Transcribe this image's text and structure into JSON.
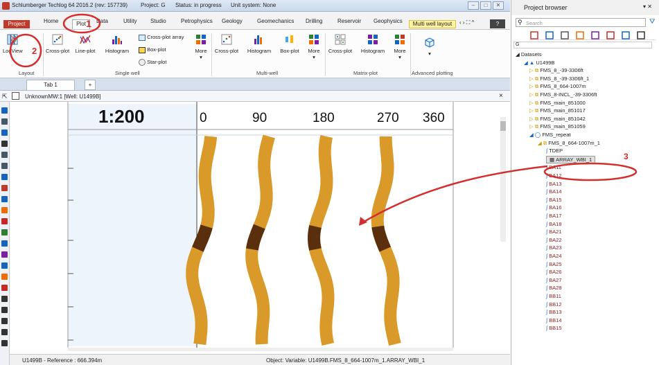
{
  "window": {
    "title": "Schlumberger Techlog 64 2016.2 (rev: 157739)",
    "project": "Project: G",
    "status": "Status: in progress",
    "unit_system": "Unit system: None"
  },
  "ribbon_tabs": [
    "Project",
    "Home",
    "Plot",
    "Data",
    "Utility",
    "Studio",
    "Petrophysics",
    "Geology",
    "Geomechanics",
    "Drilling",
    "Reservoir",
    "Geophysics",
    "Multi well layout"
  ],
  "ribbon": {
    "layout_group": "Layout",
    "single_well_group": "Single well",
    "multi_well_group": "Multi-well",
    "matrix_group": "Matrix-plot",
    "advanced_group": "Advanced plotting",
    "logview": "LogView",
    "crossplot": "Cross-plot",
    "lineplot": "Line-plot",
    "histogram": "Histogram",
    "crossplot_array": "Cross-plot array",
    "boxplot": "Box-plot",
    "starplot": "Star-plot",
    "more": "More",
    "mw_crossplot": "Cross-plot",
    "mw_histogram": "Histogram",
    "mw_boxplot": "Box-plot",
    "mw_more": "More",
    "mx_crossplot": "Cross-plot",
    "mx_histogram": "Histogram",
    "mx_more": "More"
  },
  "doc": {
    "tab": "Tab 1",
    "add_tab": "+",
    "view_title": "UnknownMW:1 [Well: U1499B]",
    "close": "×"
  },
  "log": {
    "scale": "1:200",
    "angles": [
      "0",
      "90",
      "180",
      "270",
      "360"
    ]
  },
  "annotations": {
    "a1": "1",
    "a2": "2",
    "a3": "3"
  },
  "status": {
    "left": "U1499B - Reference : 666.394m",
    "right": "Object: Variable: U1499B.FMS_8_664-1007m_1.ARRAY_WBI_1"
  },
  "project_browser": {
    "title": "Project browser",
    "search_placeholder": "Search",
    "filter": "G",
    "datasets": "Datasets",
    "well": "U1499B",
    "items": [
      "FMS_8_-39-3306ft",
      "FMS_8_-39-3306ft_1",
      "FMS_8_664-1007m",
      "FMS_8-INCL_-39-3306ft",
      "FMS_main_851000",
      "FMS_main_851017",
      "FMS_main_851042",
      "FMS_main_851059"
    ],
    "fms_repeat": "FMS_repeat",
    "fms_dataset": "FMS_8_664-1007m_1",
    "tdep": "TDEP",
    "array": "ARRAY_WBI_1",
    "vars": [
      "BA11",
      "BA12",
      "BA13",
      "BA14",
      "BA15",
      "BA16",
      "BA17",
      "BA18",
      "BA21",
      "BA22",
      "BA23",
      "BA24",
      "BA25",
      "BA26",
      "BA27",
      "BA28",
      "BB11",
      "BB12",
      "BB13",
      "BB14",
      "BB15"
    ]
  },
  "colors": {
    "accent_red": "#d32f2f",
    "image_gold": "#d99a2a",
    "image_dark": "#5a2f0d"
  }
}
